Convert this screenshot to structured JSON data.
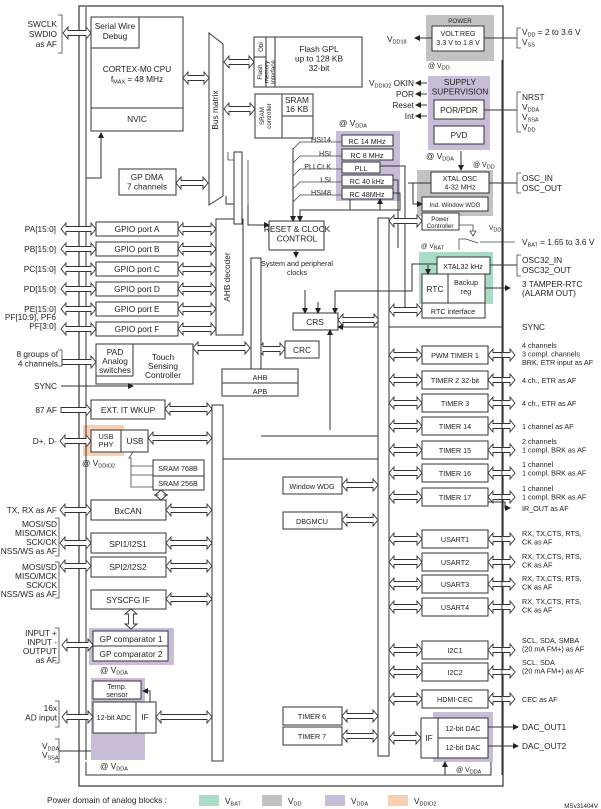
{
  "colors": {
    "vbat": "#a8dcc4",
    "vdd": "#c2c2c2",
    "vdda": "#c8bcd8",
    "vddio2": "#f8cfb0"
  },
  "left_pins": {
    "swd": [
      "SWCLK",
      "SWDIO",
      "as AF"
    ],
    "pa": "PA[15:0]",
    "pb": "PB[15:0]",
    "pc": "PC[15:0]",
    "pd": "PD[15:0]",
    "pe": "PE[15:0]",
    "pf": [
      "PF[10:9], PF6",
      "PF[3:0]"
    ],
    "touch": [
      "8 groups of",
      "4 channels"
    ],
    "sync": "SYNC",
    "af87": "87 AF",
    "usb": "D+, D-",
    "can": "TX, RX as AF",
    "spi1": [
      "MOSI/SD",
      "MISO/MCK",
      "SCK/CK",
      "NSS/WS as AF"
    ],
    "spi2": [
      "MOSI/SD",
      "MISO/MCK",
      "SCK/CK",
      "NSS/WS as AF"
    ],
    "comp": [
      "INPUT +",
      "INPUT -",
      "OUTPUT",
      "as AF"
    ],
    "adc": [
      "16x",
      "AD input"
    ],
    "vdda": [
      "VDDA",
      "VSSA"
    ]
  },
  "blocks": {
    "swd": [
      "Serial Wire",
      "Debug"
    ],
    "cpu": [
      "CORTEX-M0 CPU",
      "fMAX = 48 MHz"
    ],
    "nvic": "NVIC",
    "bus_matrix": "Bus matrix",
    "obl": "Obl",
    "flash_if": [
      "Flash",
      "memory",
      "interface"
    ],
    "flash": [
      "Flash GPL",
      "up to 128 KB",
      "32-bit"
    ],
    "sram_ctrl": [
      "SRAM",
      "controller"
    ],
    "sram": [
      "SRAM",
      "16 KB"
    ],
    "gpdma": [
      "GP DMA",
      "7 channels"
    ],
    "gpio": [
      "GPIO port A",
      "GPIO port B",
      "GPIO port C",
      "GPIO port D",
      "GPIO port E",
      "GPIO port F"
    ],
    "ahb_decoder": "AHB decoder",
    "pad": [
      "PAD",
      "Analog",
      "switches"
    ],
    "tsc": [
      "Touch",
      "Sensing",
      "Controller"
    ],
    "exti": "EXT. IT  WKUP",
    "usb_phy": [
      "USB",
      "PHY"
    ],
    "usb": "USB",
    "sram768": "SRAM 768B",
    "sram256": "SRAM 256B",
    "bxcan": "BxCAN",
    "spi1": "SPI1/I2S1",
    "spi2": "SPI2/I2S2",
    "syscfg": "SYSCFG IF",
    "comp1": "GP comparator 1",
    "comp2": "GP comparator 2",
    "temp": [
      "Temp.",
      "sensor"
    ],
    "adc": "12-bit ADC",
    "adc_if": "IF",
    "rcc": [
      "RESET & CLOCK",
      "CONTROL"
    ],
    "sysclk": [
      "System and peripheral",
      "clocks"
    ],
    "crs": "CRS",
    "crc": "CRC",
    "ahb": "AHB",
    "apb": "APB",
    "wwdg": "Window WDG",
    "dbgmcu": "DBGMCU",
    "tim6": "TIMER 6",
    "tim7": "TIMER 7",
    "rc14": "RC 14 MHz",
    "rc8": "RC 8 MHz",
    "pll": "PLL",
    "rc40": "RC 40 kHz",
    "rc48": "RC 48MHz",
    "clk_labels": [
      "HSI14",
      "HSI",
      "PLLCLK",
      "LSI",
      "HSI48"
    ],
    "power_title": "POWER",
    "voltreg": [
      "VOLT.REG",
      "3.3 V to 1.8 V"
    ],
    "supply_title": [
      "SUPPLY",
      "SUPERVISION"
    ],
    "por": "POR/PDR",
    "pvd": "PVD",
    "xtal": [
      "XTAL OSC",
      "4-32 MHz"
    ],
    "iwdg": "Ind. Window WDG",
    "pwrctrl": [
      "Power",
      "Controller"
    ],
    "xtal32": "XTAL32 kHz",
    "rtc": "RTC",
    "backup": [
      "Backup",
      "reg"
    ],
    "rtc_if": "RTC interface",
    "apb_periph": [
      "PWM TIMER 1",
      "TIMER 2 32-bit",
      "TIMER 3",
      "TIMER 14",
      "TIMER 15",
      "TIMER 16",
      "TIMER 17",
      "USART1",
      "USART2",
      "USART3",
      "USART4",
      "I2C1",
      "I2C2",
      "HDMI-CEC"
    ],
    "dac_if": "IF",
    "dac1": "12-bit  DAC",
    "dac2": "12-bit DAC"
  },
  "right_pins": {
    "vdd_range": [
      "VDD = 2 to 3.6 V",
      "VSS"
    ],
    "reset": [
      "NRST",
      "VDDA",
      "VSSA",
      "VDD"
    ],
    "osc": [
      "OSC_IN",
      "OSC_OUT"
    ],
    "vbat": "VBAT = 1.65 to 3.6 V",
    "osc32": [
      "OSC32_IN",
      "OSC32_OUT"
    ],
    "tamper": [
      "3 TAMPER-RTC",
      "(ALARM OUT)"
    ],
    "sync": "SYNC",
    "tim1": [
      "4 channels",
      "3 compl. channels",
      "BRK, ETR input as AF"
    ],
    "tim2": "4 ch., ETR as AF",
    "tim3": "4 ch., ETR as AF",
    "tim14": "1 channel as AF",
    "tim15": [
      "2 channels",
      "1 compl, BRK as AF"
    ],
    "tim16": [
      "1 channel",
      "1 compl, BRK as AF"
    ],
    "tim17": [
      "1 channel",
      "1 compl, BRK as AF"
    ],
    "irout": "IR_OUT as AF",
    "usart": [
      "RX, TX,CTS, RTS,",
      "CK as AF"
    ],
    "i2c1": [
      "SCL, SDA, SMBA",
      "(20 mA FM+) as AF"
    ],
    "i2c2": [
      "SCL, SDA",
      "(20 mA FM+) as AF"
    ],
    "cec": "CEC as AF",
    "dac1": "DAC_OUT1",
    "dac2": "DAC_OUT2"
  },
  "internal_signals": {
    "vdd18": "VDD18",
    "okin": "VDDIO2 OKIN",
    "por": "POR",
    "reset": "Reset",
    "int": "Int",
    "at_vdd": "@ VDD",
    "at_vdda": "@ VDDA",
    "at_vbat": "@ VBAT",
    "at_vddio2": "@ VDDIO2",
    "vdd": "VDD"
  },
  "legend": {
    "title": "Power domain of analog blocks :",
    "items": [
      {
        "key": "vbat",
        "label": "VBAT"
      },
      {
        "key": "vdd",
        "label": "VDD"
      },
      {
        "key": "vdda",
        "label": "VDDA"
      },
      {
        "key": "vddio2",
        "label": "VDDIO2"
      }
    ]
  },
  "figure_id": "MSv31404V"
}
